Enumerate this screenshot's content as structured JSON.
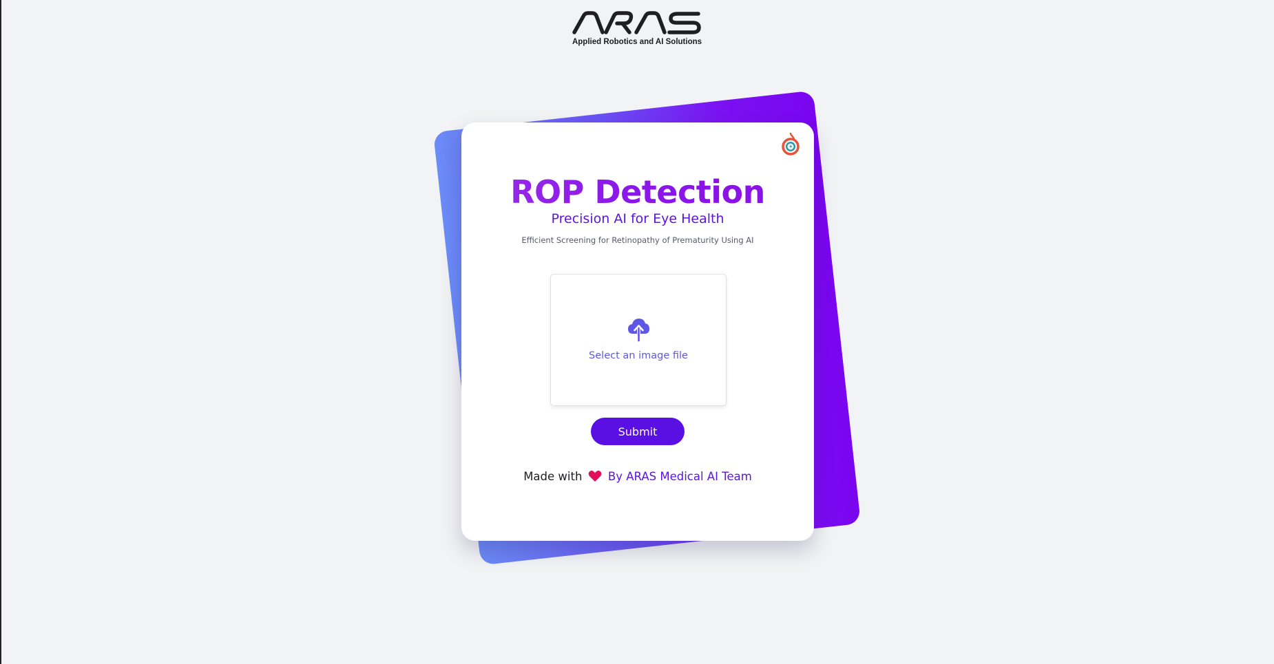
{
  "brand": {
    "logo_text": "ARAS",
    "tagline": "Applied Robotics and AI Solutions"
  },
  "card": {
    "title": "ROP Detection",
    "subtitle": "Precision AI for Eye Health",
    "tagline": "Efficient Screening for Retinopathy of Prematurity Using AI",
    "corner_icon": "logo-badge-icon"
  },
  "upload": {
    "icon": "cloud-upload-icon",
    "label": "Select an image file"
  },
  "submit": {
    "label": "Submit"
  },
  "footer": {
    "made_with": "Made with",
    "heart_icon": "heart-icon",
    "team": "By ARAS Medical AI Team"
  },
  "colors": {
    "background": "#f2f3f5",
    "title_gradient": [
      "#9a2ee8",
      "#8a12e6"
    ],
    "accent": "#5a14de",
    "button": "#5a10e2",
    "upload_accent": "#5e57e6",
    "heart": "#e0105a",
    "back_card_gradient": [
      "#6b8cf7",
      "#7a05ef"
    ]
  }
}
